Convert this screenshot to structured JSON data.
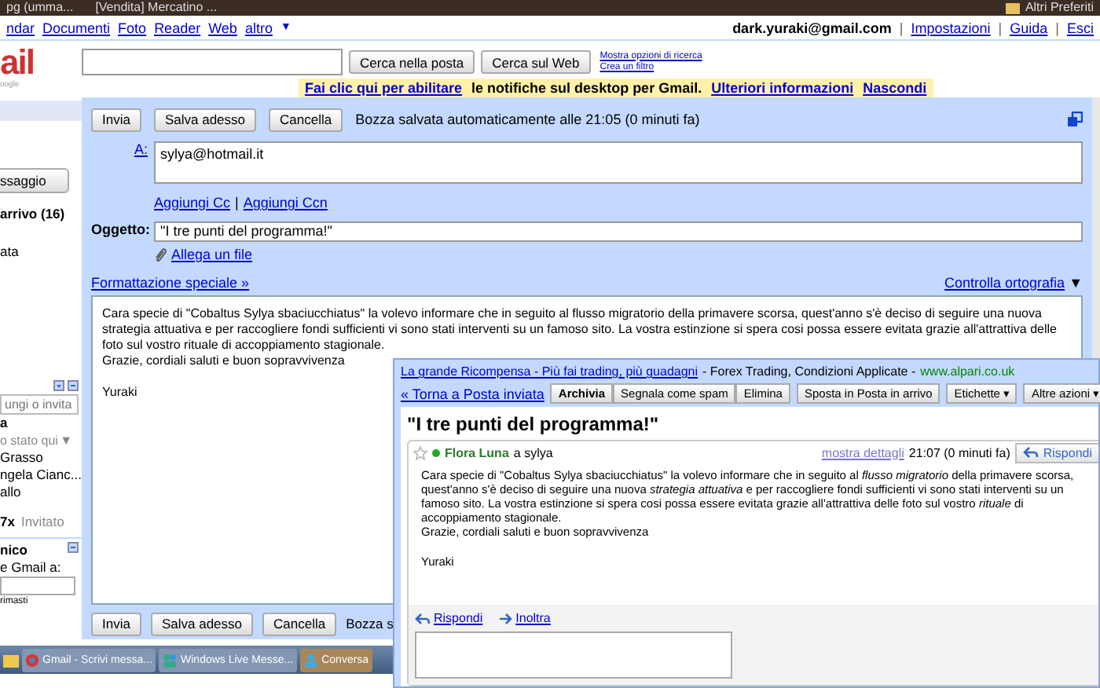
{
  "bookmarks": [
    {
      "label": "pg (umma...",
      "kind": "page"
    },
    {
      "label": "[Vendita] Mercatino ...",
      "kind": "page"
    },
    {
      "label": "Altri Preferiti",
      "kind": "folder"
    }
  ],
  "nav": {
    "links": [
      "ndar",
      "Documenti",
      "Foto",
      "Reader",
      "Web",
      "altro"
    ],
    "more_caret": "▼",
    "account": "dark.yuraki@gmail.com",
    "account_links": [
      {
        "kind": "sep",
        "text": "|"
      },
      {
        "kind": "link",
        "text": "Impostazioni"
      },
      {
        "kind": "sep",
        "text": "|"
      },
      {
        "kind": "link",
        "text": "Guida"
      },
      {
        "kind": "sep",
        "text": "|"
      },
      {
        "kind": "link",
        "text": "Esci"
      }
    ]
  },
  "header": {
    "logo": "ail",
    "logo_sub": "oogle",
    "search_buttons": [
      "Cerca nella posta",
      "Cerca sul Web"
    ],
    "search_links": [
      "Mostra opzioni di ricerca",
      "Crea un filtro"
    ]
  },
  "notification": {
    "link": "Fai clic qui per abilitare",
    "text": "le notifiche sul desktop per Gmail.",
    "links": [
      "Ulteriori informazioni",
      "Nascondi"
    ]
  },
  "sidebar": {
    "compose_button": "ssaggio",
    "inbox": "arrivo (16)",
    "items": [
      "ata"
    ],
    "chat": {
      "search_placeholder": "ungi o invita",
      "me": "a",
      "status": "o stato qui",
      "status_caret": "▼",
      "contacts": [
        "Grasso",
        "ngela Cianc...",
        "allo"
      ],
      "invite_name": "7x",
      "invite_status": "Invitato"
    },
    "invite_box": {
      "title": "nico",
      "text": "e Gmail a:",
      "footer": "rimasti"
    }
  },
  "compose": {
    "toolbar_buttons": [
      "Invia",
      "Salva adesso",
      "Cancella"
    ],
    "draft_status": "Bozza salvata automaticamente alle 21:05 (0 minuti fa)",
    "to_label": "A:",
    "to_value": "sylya@hotmail.it",
    "cc_links": [
      "Aggiungi Cc",
      "Aggiungi Ccn"
    ],
    "cc_separator": "|",
    "subject_label": "Oggetto:",
    "subject_value": "\"I tre punti del programma!\"",
    "attach_link": "Allega un file",
    "formatting_link": "Formattazione speciale »",
    "spellcheck_link": "Controlla ortografia",
    "spellcheck_caret": "▼",
    "body_paragraphs": [
      "Cara specie di  \"Cobaltus Sylya sbaciucchiatus\" la volevo informare che in seguito al flusso migratorio della primavere scorsa, quest'anno s'è deciso di seguire una nuova strategia attuativa e per raccogliere fondi sufficienti vi sono stati interventi su un famoso sito. La vostra estinzione si spera cosi possa essere evitata grazie all'attrattiva delle foto sul vostro rituale di accoppiamento stagionale.",
      "Grazie, cordiali saluti e buon sopravvivenza"
    ],
    "signature": "Yuraki",
    "bottom_buttons": [
      "Invia",
      "Salva adesso",
      "Cancella"
    ],
    "bottom_status": "Bozza s"
  },
  "taskbar": {
    "items": [
      {
        "label": "Gmail - Scrivi messa...",
        "kind": "browser",
        "selected": false
      },
      {
        "label": "Windows Live Messe...",
        "kind": "messenger",
        "selected": false
      },
      {
        "label": "Conversa",
        "kind": "conversation",
        "selected": true
      }
    ]
  },
  "popup": {
    "ad_link": "La grande Ricompensa - Più fai trading, più guadagni",
    "ad_text": "- Forex Trading, Condizioni Applicate -",
    "ad_url": "www.alpari.co.uk",
    "back_link": "« Torna a Posta inviata",
    "actions": [
      {
        "label": "Archivia",
        "kind": "primary"
      },
      {
        "label": "Segnala come spam",
        "kind": "group"
      },
      {
        "label": "Elimina",
        "kind": "group"
      },
      {
        "label": "Sposta in Posta in arrivo",
        "kind": "single"
      },
      {
        "label": "Etichette",
        "kind": "menu",
        "caret": "▾"
      },
      {
        "label": "Altre azioni",
        "kind": "menu",
        "caret": "▾"
      }
    ],
    "subject": "\"I tre punti del programma!\"",
    "message": {
      "starred": false,
      "sender": "Flora Luna",
      "recipient": "a sylya",
      "details_link": "mostra dettagli",
      "time": "21:07 (0 minuti fa)",
      "reply_button": "Rispondi",
      "body_paragraphs": [
        "Cara specie di  \"Cobaltus Sylya sbaciucchiatus\" la volevo informare che in seguito al *flusso migratorio* della primavere scorsa, quest'anno s'è deciso di seguire una nuova *strategia attuativa* e per raccogliere fondi sufficienti vi sono stati interventi su un famoso sito. La vostra estinzione si spera cosi possa essere evitata grazie all'attrattiva delle foto sul vostro *rituale* di accoppiamento stagionale.",
        "Grazie, cordiali saluti e buon sopravvivenza"
      ],
      "signature": "Yuraki"
    },
    "reply_links": [
      {
        "label": "Rispondi",
        "kind": "reply"
      },
      {
        "label": "Inoltra",
        "kind": "forward"
      }
    ]
  }
}
